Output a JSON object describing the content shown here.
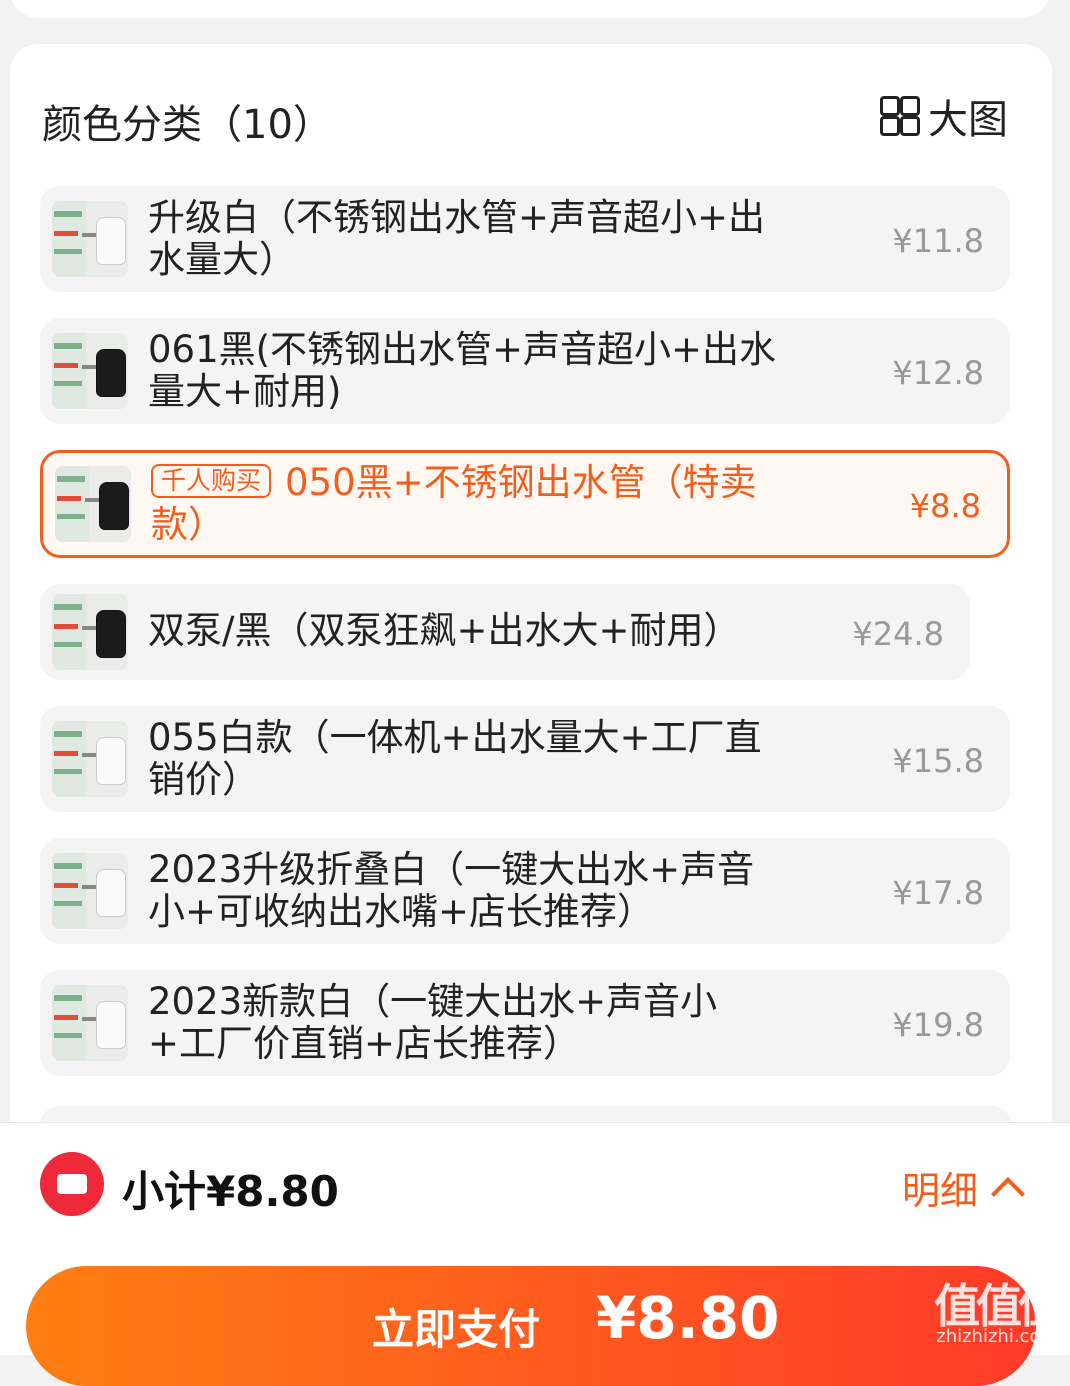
{
  "header": {
    "title": "颜色分类（10）",
    "big_view_label": "大图"
  },
  "items": [
    {
      "name": "升级白（不锈钢出水管+声音超小+出\n水量大）",
      "price": "¥11.8",
      "selected": false,
      "badge": ""
    },
    {
      "name": "061黑(不锈钢出水管+声音超小+出水\n量大+耐用)",
      "price": "¥12.8",
      "selected": false,
      "badge": ""
    },
    {
      "name": "050黑+不锈钢出水管（特卖\n款）",
      "price": "¥8.8",
      "selected": true,
      "badge": "千人购买"
    },
    {
      "name": "双泵/黑（双泵狂飙+出水大+耐用）",
      "price": "¥24.8",
      "selected": false,
      "badge": ""
    },
    {
      "name": "055白款（一体机+出水量大+工厂直\n销价）",
      "price": "¥15.8",
      "selected": false,
      "badge": ""
    },
    {
      "name": "2023升级折叠白（一键大出水+声音\n小+可收纳出水嘴+店长推荐）",
      "price": "¥17.8",
      "selected": false,
      "badge": ""
    },
    {
      "name": "2023新款白（一键大出水+声音小\n+工厂价直销+店长推荐）",
      "price": "¥19.8",
      "selected": false,
      "badge": ""
    }
  ],
  "footer": {
    "subtotal": "小计¥8.80",
    "detail_label": "明细",
    "pay_label": "立即支付",
    "pay_amount": "¥8.80"
  },
  "watermark": {
    "title": "值值值",
    "site": "zhizhizhi.com"
  },
  "colors": {
    "accent": "#f25f1d",
    "pay_gradient_start": "#ff7e12",
    "pay_gradient_end": "#ff3a2a",
    "coupon": "#ee2a3a"
  }
}
